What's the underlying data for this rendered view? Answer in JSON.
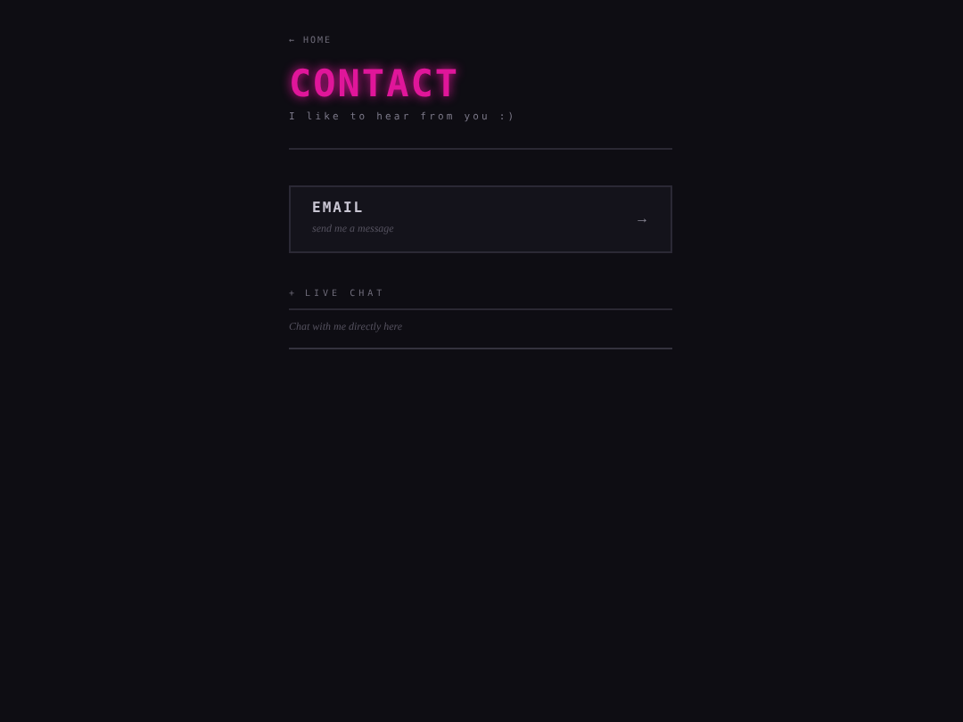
{
  "back_link": {
    "arrow": "←",
    "label": "HOME"
  },
  "title": "CONTACT",
  "subtitle": "I like to hear from you :)",
  "cards": [
    {
      "title": "EMAIL",
      "description": "send me a message",
      "arrow": "→"
    }
  ],
  "live_chat": {
    "marker": "+",
    "heading": "LIVE CHAT",
    "text": "Chat with me directly here"
  }
}
